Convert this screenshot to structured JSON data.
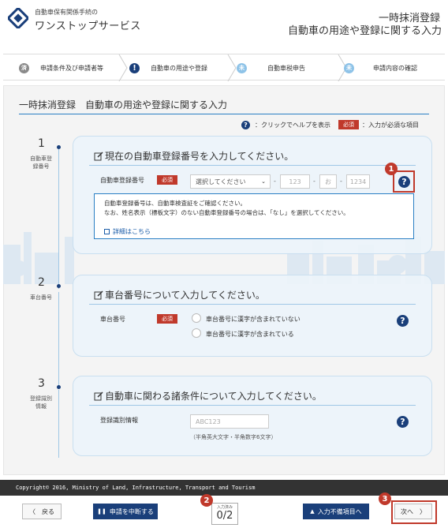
{
  "header": {
    "logo_small": "自動車保有関係手続の",
    "logo_big": "ワンストップサービス",
    "title_line1": "一時抹消登録",
    "title_line2": "自動車の用途や登録に関する入力"
  },
  "steps": [
    {
      "label": "申請条件及び申請者等",
      "state": "done",
      "icon": "check-icon",
      "glyph": "済"
    },
    {
      "label": "自動車の用途や登録",
      "state": "current",
      "icon": "exclamation-icon",
      "glyph": "!"
    },
    {
      "label": "自動車税申告",
      "state": "todo",
      "icon": "todo-icon",
      "glyph": "未"
    },
    {
      "label": "申請内容の確認",
      "state": "todo",
      "icon": "todo-icon",
      "glyph": "未"
    }
  ],
  "page": {
    "title": "一時抹消登録　自動車の用途や登録に関する入力",
    "legend_help": "：クリックでヘルプを表示",
    "legend_required_badge": "必須",
    "legend_required": "：入力が必須な項目"
  },
  "sections": [
    {
      "number": "1",
      "label_line1": "自動車登",
      "label_line2": "録番号",
      "title": "現在の自動車登録番号を入力してください。",
      "field_label": "自動車登録番号",
      "required": "必須",
      "select_value": "選択してください",
      "input1_placeholder": "123",
      "input2_placeholder": "お",
      "input3_placeholder": "1234",
      "info_line1": "自動車登録番号は、自動車検査証をご確認ください。",
      "info_line2": "なお、姓名表示（標板文字）のない自動車登録番号の場合は、「なし」を選択してください。",
      "info_link": "詳細はこちら"
    },
    {
      "number": "2",
      "label_line1": "車台番号",
      "title": "車台番号について入力してください。",
      "field_label": "車台番号",
      "required": "必須",
      "radio1": "車台番号に漢字が含まれていない",
      "radio2": "車台番号に漢字が含まれている"
    },
    {
      "number": "3",
      "label_line1": "登録識別",
      "label_line2": "情報",
      "title": "自動車に関わる諸条件について入力してください。",
      "field_label": "登録識別情報",
      "input_placeholder": "ABC123",
      "hint": "（半角英大文字・半角数字6文字）"
    }
  ],
  "annotations": [
    "1",
    "2",
    "3"
  ],
  "footer": {
    "copyright": "Copyright© 2016, Ministry of Land, Infrastructure, Transport and Tourism"
  },
  "bottom": {
    "back": "〈　戻る",
    "suspend": "申請を中断する",
    "counter_label": "入力済み",
    "counter_value": "0/2",
    "skip": "入力不備項目へ",
    "next": "次へ　〉"
  },
  "colors": {
    "primary": "#1a3f7a",
    "required": "#c0392b",
    "accent_line": "#2a7fc4",
    "card_bg": "#ebf3fa"
  }
}
